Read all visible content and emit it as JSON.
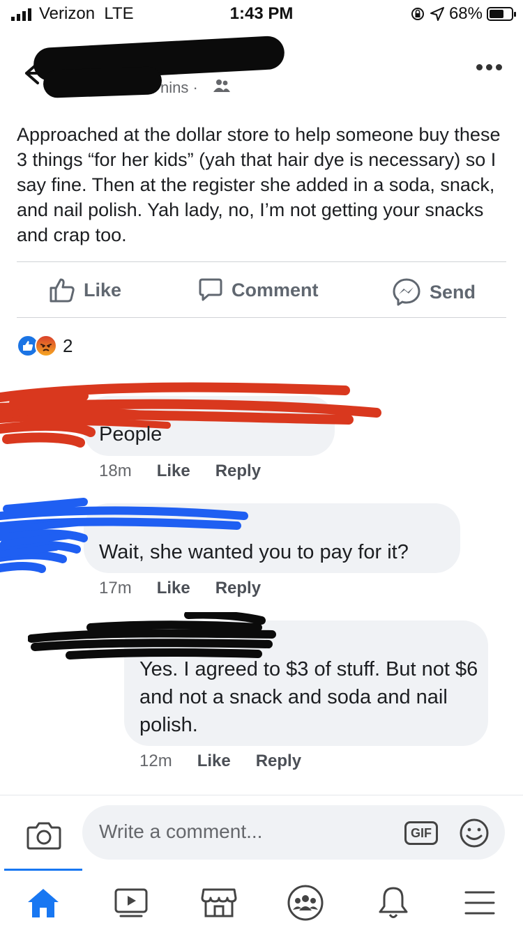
{
  "status_bar": {
    "carrier": "Verizon",
    "network": "LTE",
    "time": "1:43 PM",
    "battery_text": "68%",
    "battery_level": 0.68
  },
  "post": {
    "meta_suffix": "nins ·",
    "text": "Approached at the dollar store to help someone buy these 3 things “for her kids” (yah that hair dye is necessary) so I say fine. Then at the register she added in a soda, snack, and nail polish. Yah lady, no, I’m not getting your snacks and crap too."
  },
  "actions": {
    "like": "Like",
    "comment": "Comment",
    "send": "Send"
  },
  "reactions": {
    "count": "2"
  },
  "comments": [
    {
      "text": "People",
      "time": "18m",
      "like": "Like",
      "reply": "Reply"
    },
    {
      "text": "Wait, she wanted you to pay for it?",
      "time": "17m",
      "like": "Like",
      "reply": "Reply"
    },
    {
      "text": "Yes. I agreed to $3 of stuff. But not $6 and not a snack and soda and nail polish.",
      "time": "12m",
      "like": "Like",
      "reply": "Reply"
    }
  ],
  "composer": {
    "placeholder": "Write a comment...",
    "gif_label": "GIF"
  },
  "colors": {
    "accent": "#1877f2",
    "redaction_black": "#0b0b0b",
    "redaction_red": "#d9381e",
    "redaction_blue": "#1f5ff2"
  }
}
